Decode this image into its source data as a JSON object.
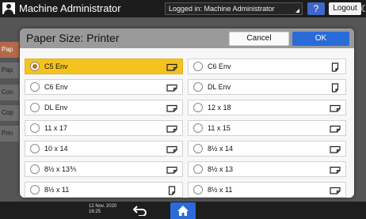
{
  "header": {
    "title": "Machine Administrator",
    "login_status": "Logged in: Machine Administrator",
    "help_label": "?",
    "logout_label": "Logout"
  },
  "background_tabs": [
    "Pap",
    "Pap",
    "Con",
    "Cop",
    "Prin"
  ],
  "dialog": {
    "title": "Paper Size: Printer",
    "cancel_label": "Cancel",
    "ok_label": "OK",
    "options": [
      {
        "label": "C5 Env",
        "orientation": "landscape",
        "selected": true
      },
      {
        "label": "C6 Env",
        "orientation": "portrait",
        "selected": false
      },
      {
        "label": "C6 Env",
        "orientation": "landscape",
        "selected": false
      },
      {
        "label": "DL Env",
        "orientation": "portrait",
        "selected": false
      },
      {
        "label": "DL Env",
        "orientation": "landscape",
        "selected": false
      },
      {
        "label": "12 x 18",
        "orientation": "landscape",
        "selected": false
      },
      {
        "label": "11 x 17",
        "orientation": "landscape",
        "selected": false
      },
      {
        "label": "11 x 15",
        "orientation": "landscape",
        "selected": false
      },
      {
        "label": "10 x 14",
        "orientation": "landscape",
        "selected": false
      },
      {
        "label": "8½ x 14",
        "orientation": "landscape",
        "selected": false
      },
      {
        "label": "8½ x 13⅗",
        "orientation": "landscape",
        "selected": false
      },
      {
        "label": "8½ x 13",
        "orientation": "landscape",
        "selected": false
      },
      {
        "label": "8½ x 11",
        "orientation": "portrait",
        "selected": false
      },
      {
        "label": "8½ x 11",
        "orientation": "landscape",
        "selected": false
      }
    ]
  },
  "footer": {
    "date": "12 Nov. 2020",
    "time": "16:25"
  },
  "colors": {
    "accent": "#2a6bd9",
    "selected": "#f5c21f"
  }
}
